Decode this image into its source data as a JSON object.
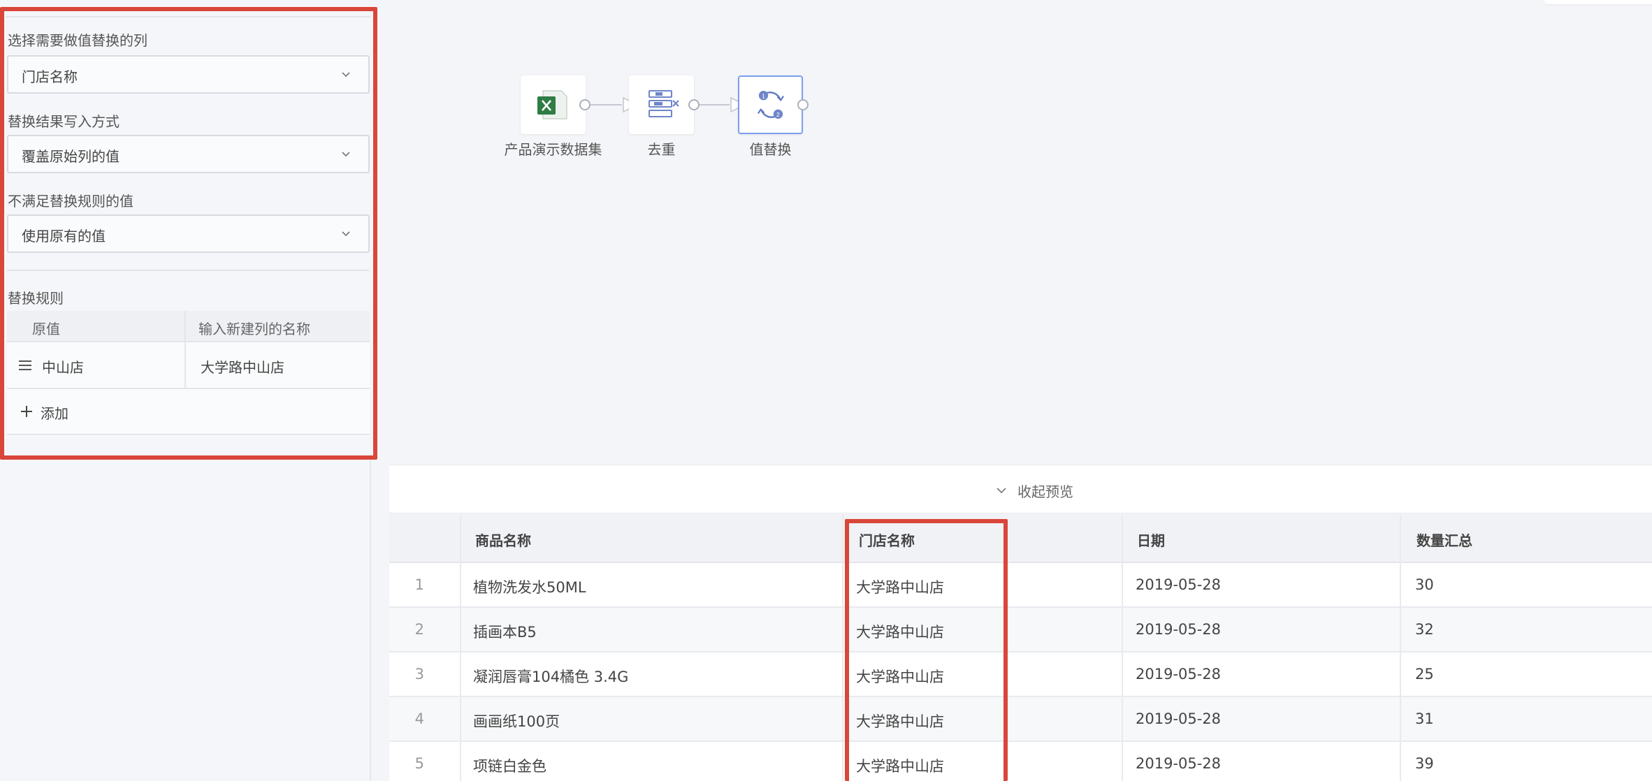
{
  "left_panel": {
    "column_label": "选择需要做值替换的列",
    "column_value": "门店名称",
    "write_mode_label": "替换结果写入方式",
    "write_mode_value": "覆盖原始列的值",
    "unmatched_label": "不满足替换规则的值",
    "unmatched_value": "使用原有的值",
    "rules_label": "替换规则",
    "rules_header": {
      "original": "原值",
      "new": "输入新建列的名称"
    },
    "rules": [
      {
        "original": "中山店",
        "new": "大学路中山店"
      }
    ],
    "add_label": "添加"
  },
  "flow": {
    "nodes": [
      {
        "label": "产品演示数据集",
        "icon": "excel-icon"
      },
      {
        "label": "去重",
        "icon": "dedupe-icon"
      },
      {
        "label": "值替换",
        "icon": "replace-icon"
      }
    ]
  },
  "preview": {
    "collapse_label": "收起预览",
    "columns": [
      "商品名称",
      "门店名称",
      "日期",
      "数量汇总"
    ],
    "rows": [
      {
        "index": "1",
        "product": "植物洗发水50ML",
        "store": "大学路中山店",
        "date": "2019-05-28",
        "qty": "30"
      },
      {
        "index": "2",
        "product": "插画本B5",
        "store": "大学路中山店",
        "date": "2019-05-28",
        "qty": "32"
      },
      {
        "index": "3",
        "product": "凝润唇膏104橘色 3.4G",
        "store": "大学路中山店",
        "date": "2019-05-28",
        "qty": "25"
      },
      {
        "index": "4",
        "product": "画画纸100页",
        "store": "大学路中山店",
        "date": "2019-05-28",
        "qty": "31"
      },
      {
        "index": "5",
        "product": "项链白金色",
        "store": "大学路中山店",
        "date": "2019-05-28",
        "qty": "39"
      }
    ]
  },
  "colors": {
    "highlight": "#d9463a",
    "accent": "#7c9ef0"
  }
}
